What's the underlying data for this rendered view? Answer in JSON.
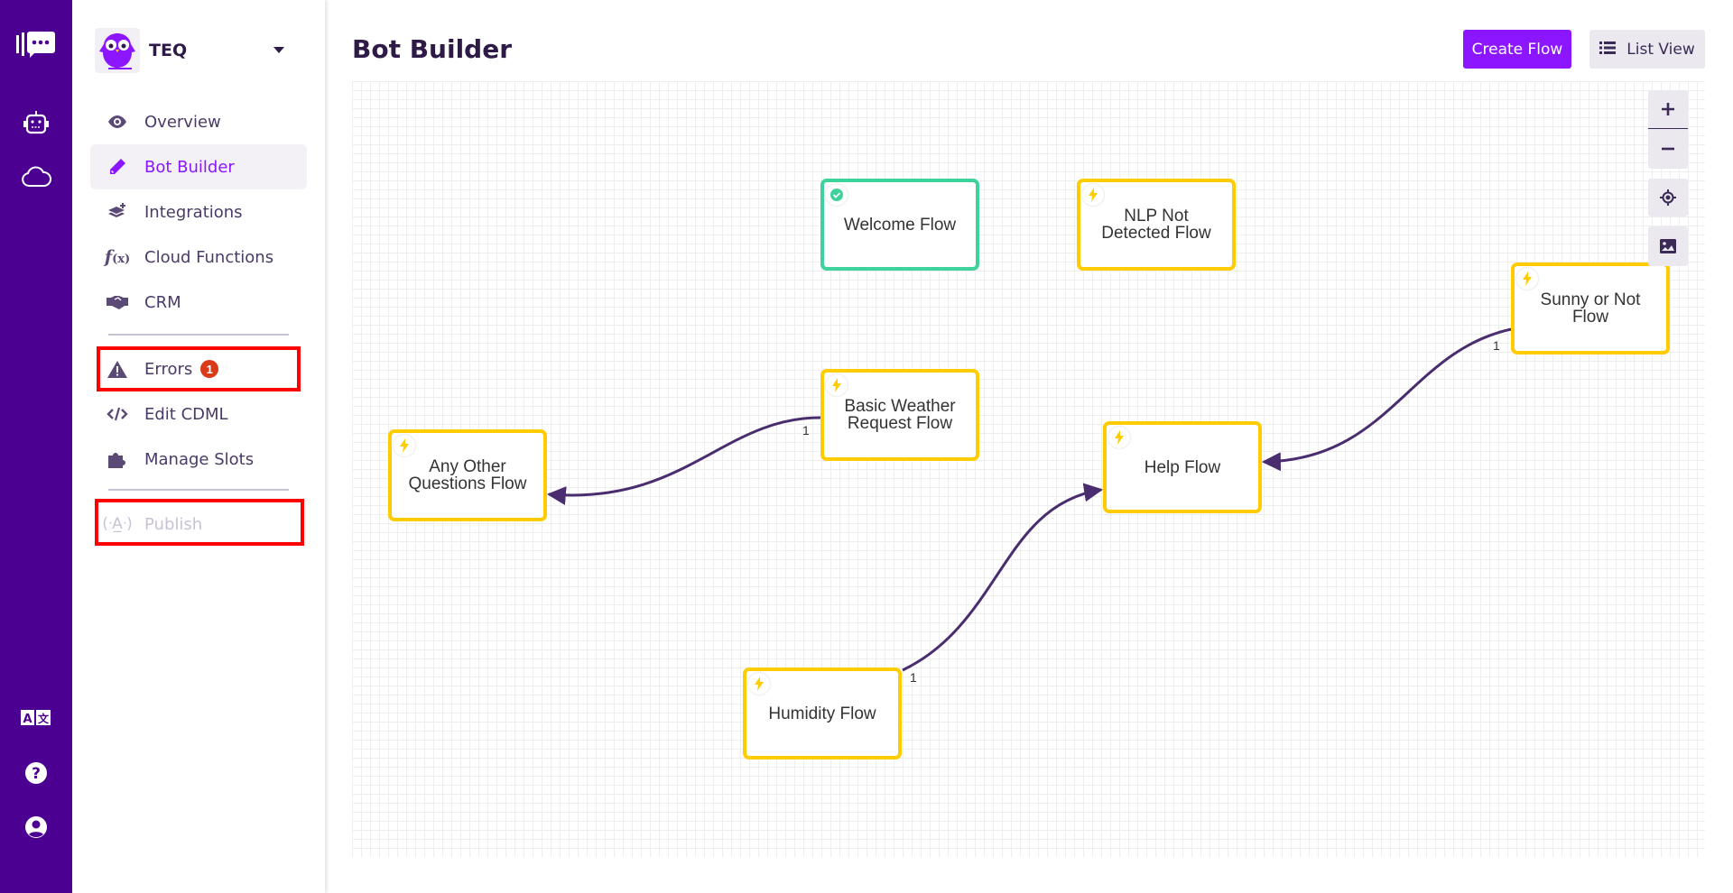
{
  "rail": {
    "icons": [
      "logo-chat-icon",
      "bot-icon",
      "cloud-icon",
      "translate-icon",
      "help-icon",
      "user-account-icon"
    ]
  },
  "workspace": {
    "name": "TEQ"
  },
  "nav": {
    "items": [
      {
        "label": "Overview",
        "icon": "eye-icon"
      },
      {
        "label": "Bot Builder",
        "icon": "pencil-icon",
        "active": true
      },
      {
        "label": "Integrations",
        "icon": "layers-plus-icon"
      },
      {
        "label": "Cloud Functions",
        "icon": "function-icon"
      },
      {
        "label": "CRM",
        "icon": "handshake-icon"
      },
      {
        "label": "Errors",
        "icon": "warning-icon",
        "badge": "1"
      },
      {
        "label": "Edit CDML",
        "icon": "code-icon"
      },
      {
        "label": "Manage Slots",
        "icon": "puzzle-icon"
      },
      {
        "label": "Publish",
        "icon": "broadcast-icon",
        "disabled": true
      }
    ]
  },
  "header": {
    "title": "Bot Builder",
    "create_flow": "Create Flow",
    "list_view": "List View"
  },
  "canvas": {
    "controls": [
      "zoom-in",
      "zoom-out",
      "recenter",
      "export-image"
    ],
    "colors": {
      "start": "#3dd39a",
      "flow": "#ffcc00",
      "edge": "#4a2d6e"
    },
    "nodes": [
      {
        "id": "welcome",
        "label": "Welcome Flow",
        "type": "start"
      },
      {
        "id": "nlp",
        "label": "NLP Not Detected Flow",
        "type": "flow"
      },
      {
        "id": "sunny",
        "label": "Sunny or Not Flow",
        "type": "flow"
      },
      {
        "id": "weather",
        "label": "Basic Weather Request Flow",
        "type": "flow"
      },
      {
        "id": "other",
        "label": "Any Other Questions Flow",
        "type": "flow"
      },
      {
        "id": "help",
        "label": "Help Flow",
        "type": "flow"
      },
      {
        "id": "humidity",
        "label": "Humidity Flow",
        "type": "flow"
      }
    ],
    "edges": [
      {
        "from": "weather",
        "to": "other",
        "label": "1"
      },
      {
        "from": "sunny",
        "to": "help",
        "label": "1"
      },
      {
        "from": "humidity",
        "to": "help",
        "label": "1"
      }
    ]
  }
}
